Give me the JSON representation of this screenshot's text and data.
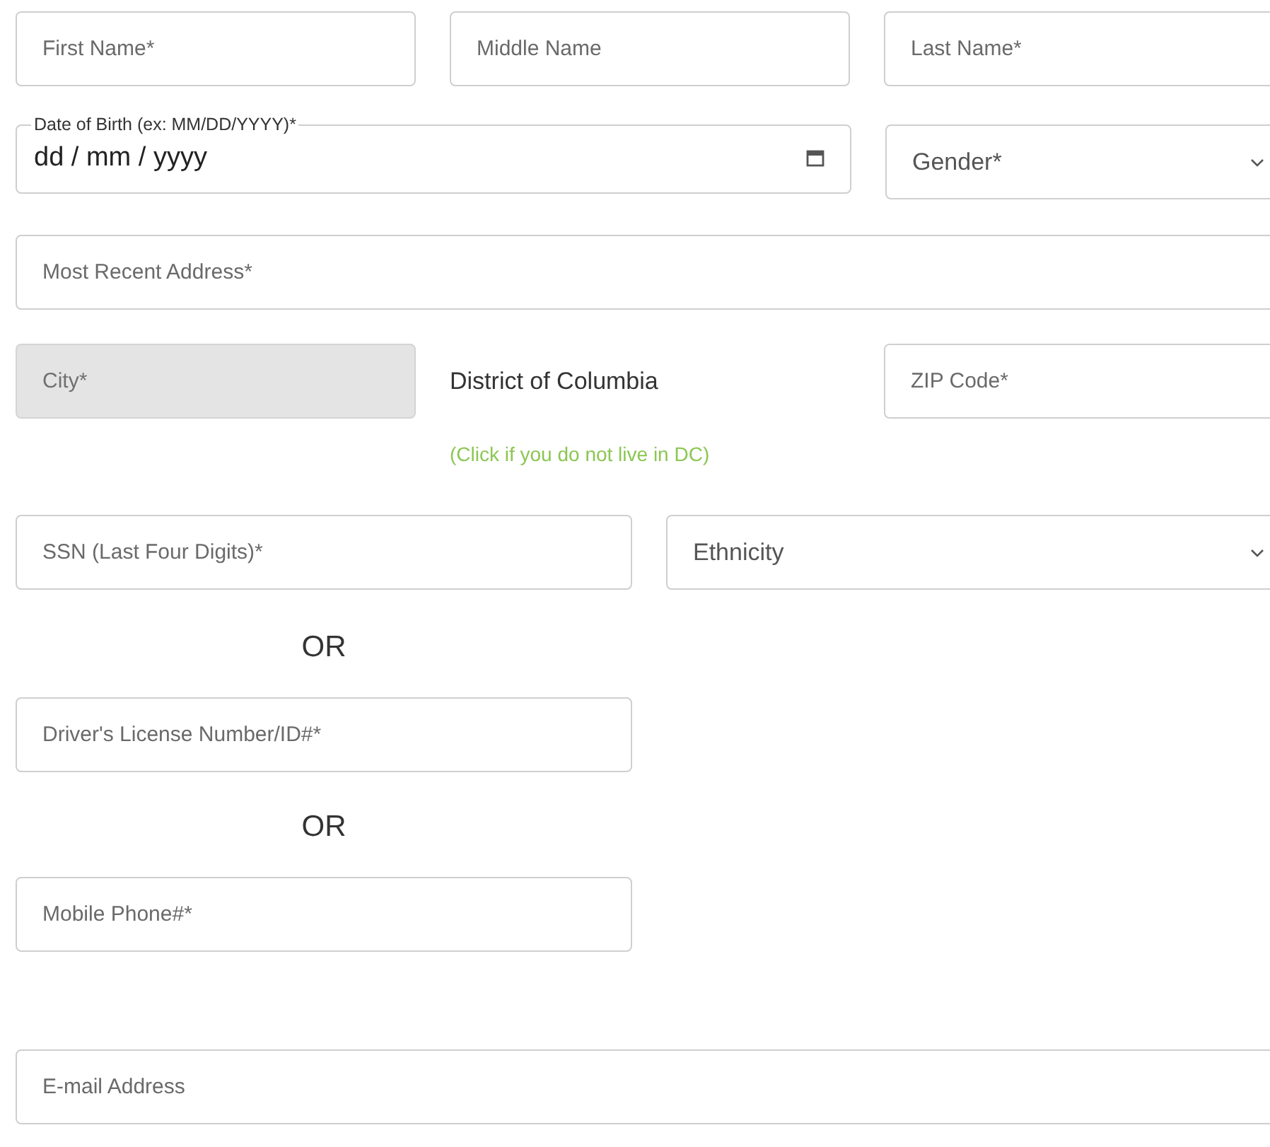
{
  "name_row": [
    {
      "placeholder": "First Name*"
    },
    {
      "placeholder": "Middle Name"
    },
    {
      "placeholder": "Last Name*"
    }
  ],
  "date_of_birth": {
    "label": "Date of Birth (ex: MM/DD/YYYY)*",
    "value": "dd / mm / yyyy"
  },
  "gender": {
    "placeholder": "Gender*"
  },
  "address": {
    "placeholder": "Most Recent Address*"
  },
  "city": {
    "placeholder": "City*",
    "disabled": true
  },
  "state": {
    "value": "District of Columbia",
    "hint": "(Click if you do not live in DC)"
  },
  "zip": {
    "placeholder": "ZIP Code*"
  },
  "ssn": {
    "placeholder": "SSN (Last Four Digits)*"
  },
  "ethnicity": {
    "placeholder": "Ethnicity"
  },
  "alternatives": [
    {
      "kind": "separator",
      "text": "OR"
    },
    {
      "kind": "field",
      "placeholder": "Driver's License Number/ID#*"
    },
    {
      "kind": "separator",
      "text": "OR"
    },
    {
      "kind": "field",
      "placeholder": "Mobile Phone#*"
    }
  ],
  "email": {
    "placeholder": "E-mail Address"
  }
}
